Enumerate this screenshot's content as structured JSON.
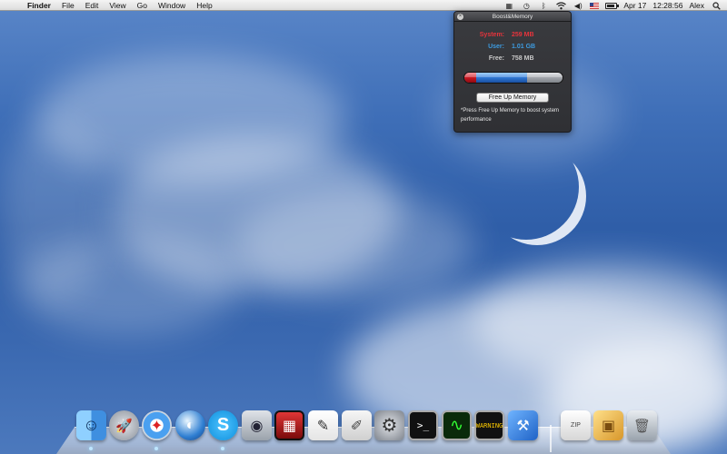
{
  "menubar": {
    "app_name": "Finder",
    "items": [
      "File",
      "Edit",
      "View",
      "Go",
      "Window",
      "Help"
    ],
    "date": "Apr 17",
    "time": "12:28:56",
    "user": "Alex"
  },
  "panel": {
    "title": "Boost&Memory",
    "system_label": "System:",
    "system_value": "259 MB",
    "user_label": "User:",
    "user_value": "1.01 GB",
    "free_label": "Free:",
    "free_value": "758 MB",
    "button_label": "Free Up Memory",
    "note": "*Press Free Up Memory to boost system performance",
    "usage_fractions": {
      "system": 0.12,
      "user": 0.52,
      "free": 0.36
    },
    "colors": {
      "system": "#e8343c",
      "user": "#3d9be0",
      "free": "#c9c9c9"
    }
  },
  "dock": {
    "items": [
      {
        "name": "finder-icon",
        "glyph": "☺",
        "running": true
      },
      {
        "name": "launchpad-icon",
        "glyph": "🚀",
        "running": false
      },
      {
        "name": "safari-icon",
        "glyph": "✦",
        "running": true
      },
      {
        "name": "browser-icon",
        "glyph": "◐",
        "running": false
      },
      {
        "name": "skype-icon",
        "glyph": "S",
        "running": true
      },
      {
        "name": "facetime-icon",
        "glyph": "◉",
        "running": false
      },
      {
        "name": "photo-booth-icon",
        "glyph": "▦",
        "running": false
      },
      {
        "name": "textedit-icon",
        "glyph": "✎",
        "running": false
      },
      {
        "name": "preview-icon",
        "glyph": "✐",
        "running": false
      },
      {
        "name": "system-preferences-icon",
        "glyph": "⚙",
        "running": false
      },
      {
        "name": "terminal-icon",
        "glyph": ">_",
        "running": false
      },
      {
        "name": "activity-monitor-icon",
        "glyph": "∿",
        "running": false
      },
      {
        "name": "console-icon",
        "glyph": "WARNING",
        "running": false
      },
      {
        "name": "xcode-icon",
        "glyph": "⚒",
        "running": false
      },
      {
        "name": "archive-icon",
        "glyph": "ZIP",
        "running": false
      },
      {
        "name": "package-icon",
        "glyph": "▣",
        "running": false
      },
      {
        "name": "trash-icon",
        "glyph": "🗑",
        "running": false
      }
    ]
  }
}
